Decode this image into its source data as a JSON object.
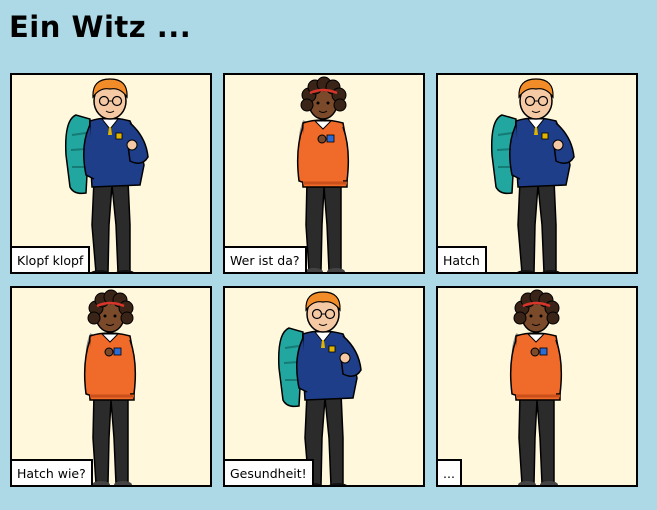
{
  "title": "Ein Witz ...",
  "colors": {
    "background": "#add8e6",
    "panel": "#fff8dc",
    "jumper_boy": "#1f3e8a",
    "jumper_girl": "#f06a2a",
    "backpack": "#22a7a0",
    "hair_boy": "#f28c28",
    "hair_girl": "#3a2418",
    "trousers": "#2b2b2b"
  },
  "panels": [
    {
      "character": "boy",
      "caption": "Klopf klopf"
    },
    {
      "character": "girl",
      "caption": "Wer ist da?"
    },
    {
      "character": "boy",
      "caption": "Hatch"
    },
    {
      "character": "girl",
      "caption": "Hatch wie?"
    },
    {
      "character": "boy",
      "caption": "Gesundheit!"
    },
    {
      "character": "girl",
      "caption": "..."
    }
  ]
}
